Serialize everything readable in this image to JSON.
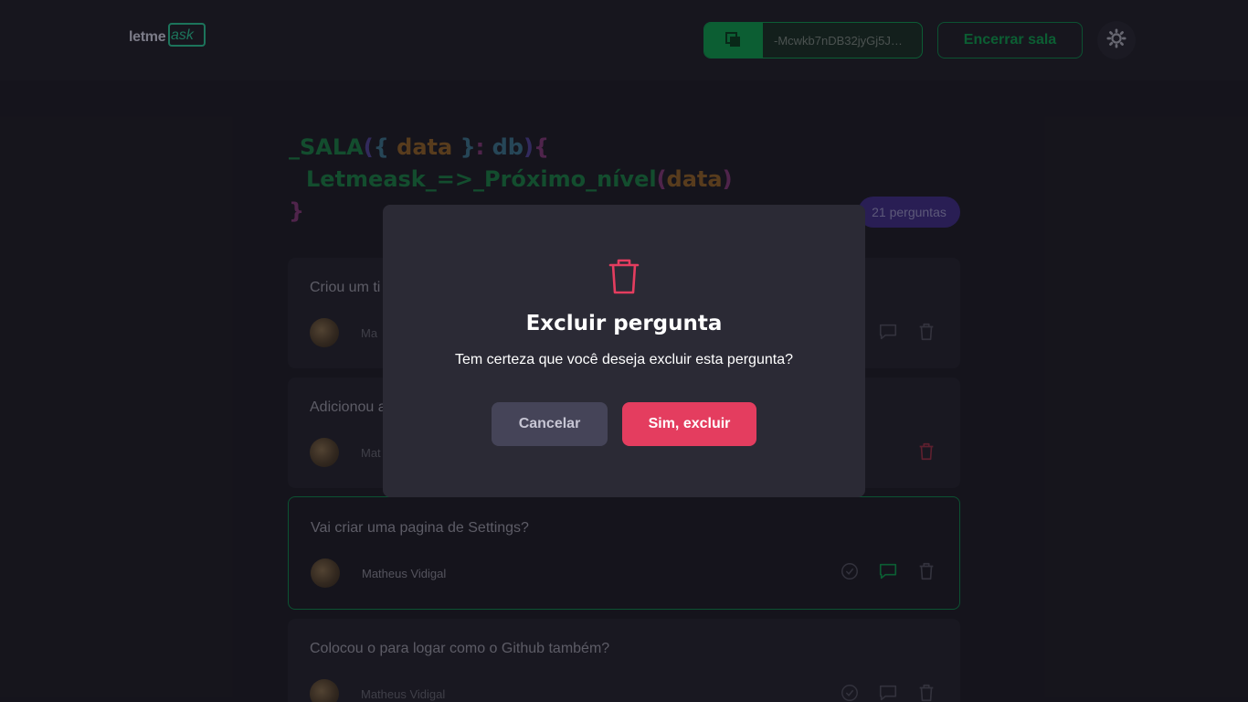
{
  "header": {
    "logo_text_left": "letme",
    "logo_text_right": "ask",
    "room_code": "-Mcwkb7nDB32jyGj5J…",
    "close_room_label": "Encerrar sala"
  },
  "room": {
    "title_line1": [
      "_SALA",
      "(",
      "{",
      " data ",
      "}",
      ":",
      " db",
      ")",
      "{"
    ],
    "title_line2": [
      "Letmeask_=>_Próximo_nível",
      "(",
      "data",
      ")"
    ],
    "title_line3": "}",
    "question_count": "21 perguntas"
  },
  "questions": [
    {
      "text": "Criou um ti",
      "author": "Ma"
    },
    {
      "text": "Adicionou a",
      "author": "Mat"
    },
    {
      "text": "Vai criar uma pagina de Settings?",
      "author": "Matheus Vidigal"
    },
    {
      "text": "Colocou o para logar como o Github também?",
      "author": "Matheus Vidigal"
    }
  ],
  "modal": {
    "title": "Excluir pergunta",
    "message": "Tem certeza que você deseja excluir esta pergunta?",
    "cancel_label": "Cancelar",
    "confirm_label": "Sim, excluir"
  },
  "colors": {
    "brand_green": "#0e8d47",
    "danger": "#e43d5f",
    "badge_purple": "#3b2a7a"
  },
  "icons": [
    "copy-icon",
    "sun-icon",
    "check-circle-icon",
    "chat-icon",
    "trash-icon"
  ]
}
